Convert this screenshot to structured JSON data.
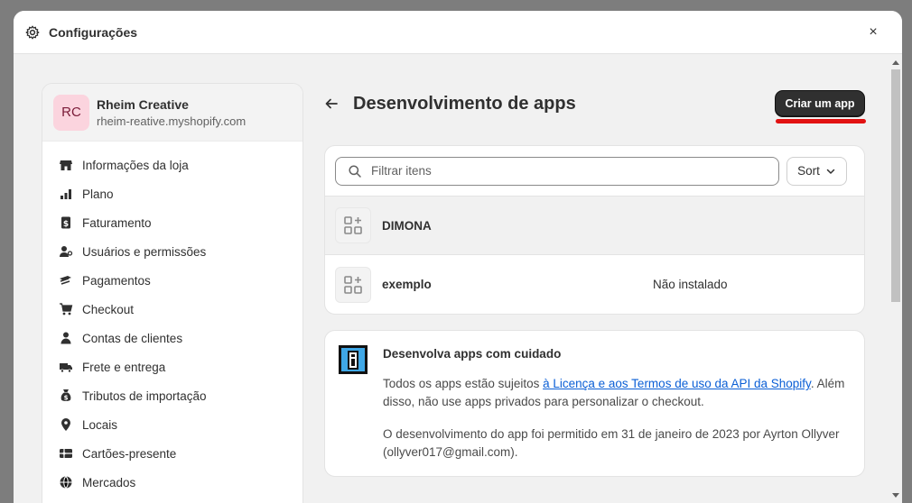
{
  "modal": {
    "title": "Configurações",
    "close_label": "×"
  },
  "store": {
    "initials": "RC",
    "name": "Rheim Creative",
    "domain": "rheim-reative.myshopify.com"
  },
  "sidebar": {
    "items": [
      {
        "label": "Informações da loja",
        "icon": "store-icon"
      },
      {
        "label": "Plano",
        "icon": "plan-chart-icon"
      },
      {
        "label": "Faturamento",
        "icon": "billing-icon"
      },
      {
        "label": "Usuários e permissões",
        "icon": "users-icon"
      },
      {
        "label": "Pagamentos",
        "icon": "payments-icon"
      },
      {
        "label": "Checkout",
        "icon": "cart-icon"
      },
      {
        "label": "Contas de clientes",
        "icon": "person-icon"
      },
      {
        "label": "Frete e entrega",
        "icon": "truck-icon"
      },
      {
        "label": "Tributos de importação",
        "icon": "duties-icon"
      },
      {
        "label": "Locais",
        "icon": "location-icon"
      },
      {
        "label": "Cartões-presente",
        "icon": "gift-card-icon"
      },
      {
        "label": "Mercados",
        "icon": "globe-icon"
      }
    ]
  },
  "page": {
    "title": "Desenvolvimento de apps",
    "create_button": "Criar um app"
  },
  "filter": {
    "placeholder": "Filtrar itens",
    "sort_label": "Sort"
  },
  "apps": [
    {
      "name": "DIMONA",
      "status": ""
    },
    {
      "name": "exemplo",
      "status": "Não instalado"
    }
  ],
  "info": {
    "title": "Desenvolva apps com cuidado",
    "text_before_link": "Todos os apps estão sujeitos ",
    "link": "à Licença e aos Termos de uso da API da Shopify",
    "text_after_link": ". Além disso, não use apps privados para personalizar o checkout.",
    "permission_text": "O desenvolvimento do app foi permitido em 31 de janeiro de 2023 por Ayrton Ollyver (ollyver017@gmail.com)."
  },
  "colors": {
    "accent_link": "#0b5fd6",
    "primary_button": "#303030",
    "annotation_red": "#e21212",
    "avatar_bg": "#fbd4de"
  }
}
